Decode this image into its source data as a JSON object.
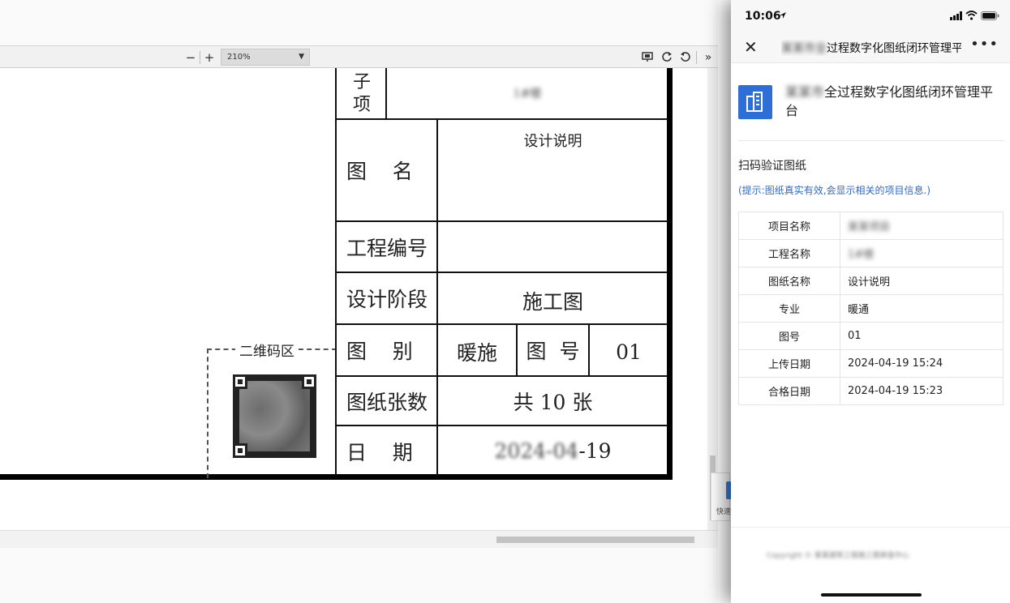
{
  "viewer": {
    "zoom_value": "210%",
    "zoom_out_label": "−",
    "zoom_in_label": "+"
  },
  "drawing": {
    "subitem_label": "子项",
    "subitem_value": "1#楼",
    "drawing_name_label": "图    名",
    "drawing_name_value": "设计说明",
    "project_number_label": "工程编号",
    "project_number_value": "",
    "design_stage_label": "设计阶段",
    "design_stage_value": "施工图",
    "category_label": "图    别",
    "category_value": "暖施",
    "drawing_number_label": "图  号",
    "drawing_number_value": "01",
    "sheet_count_label": "图纸张数",
    "sheet_count_value": "共 10 张",
    "date_label": "日    期",
    "date_value": "2024-04-19",
    "qr_zone_label": "二维码区"
  },
  "float_widget": {
    "label": "快速"
  },
  "phone": {
    "status_time": "10:06",
    "nav_title": "某某市全过程数字化图纸闭环管理平台",
    "app_title": "某某市全过程数字化图纸闭环管理平台",
    "section_title": "扫码验证图纸",
    "hint": "(提示:图纸真实有效,会显示相关的项目信息.)",
    "rows": [
      {
        "key": "项目名称",
        "value": "某某项目",
        "blurred": true
      },
      {
        "key": "工程名称",
        "value": "1#楼",
        "blurred": true
      },
      {
        "key": "图纸名称",
        "value": "设计说明",
        "blurred": false
      },
      {
        "key": "专业",
        "value": "暖通",
        "blurred": false
      },
      {
        "key": "图号",
        "value": "01",
        "blurred": false
      },
      {
        "key": "上传日期",
        "value": "2024-04-19 15:24",
        "blurred": false
      },
      {
        "key": "合格日期",
        "value": "2024-04-19 15:23",
        "blurred": false
      }
    ],
    "copyright": "Copyright © 某某建筑工程施工图审查中心"
  },
  "colors": {
    "accent_blue": "#2d6fd6",
    "hint_blue": "#2f6ac8"
  },
  "icons": [
    "close-icon",
    "more-icon",
    "location-arrow-icon",
    "signal-icon",
    "wifi-icon",
    "battery-icon",
    "app-logo-icon",
    "present-icon",
    "rotate-cw-icon",
    "rotate-ccw-icon",
    "chevron-double-right-icon"
  ]
}
